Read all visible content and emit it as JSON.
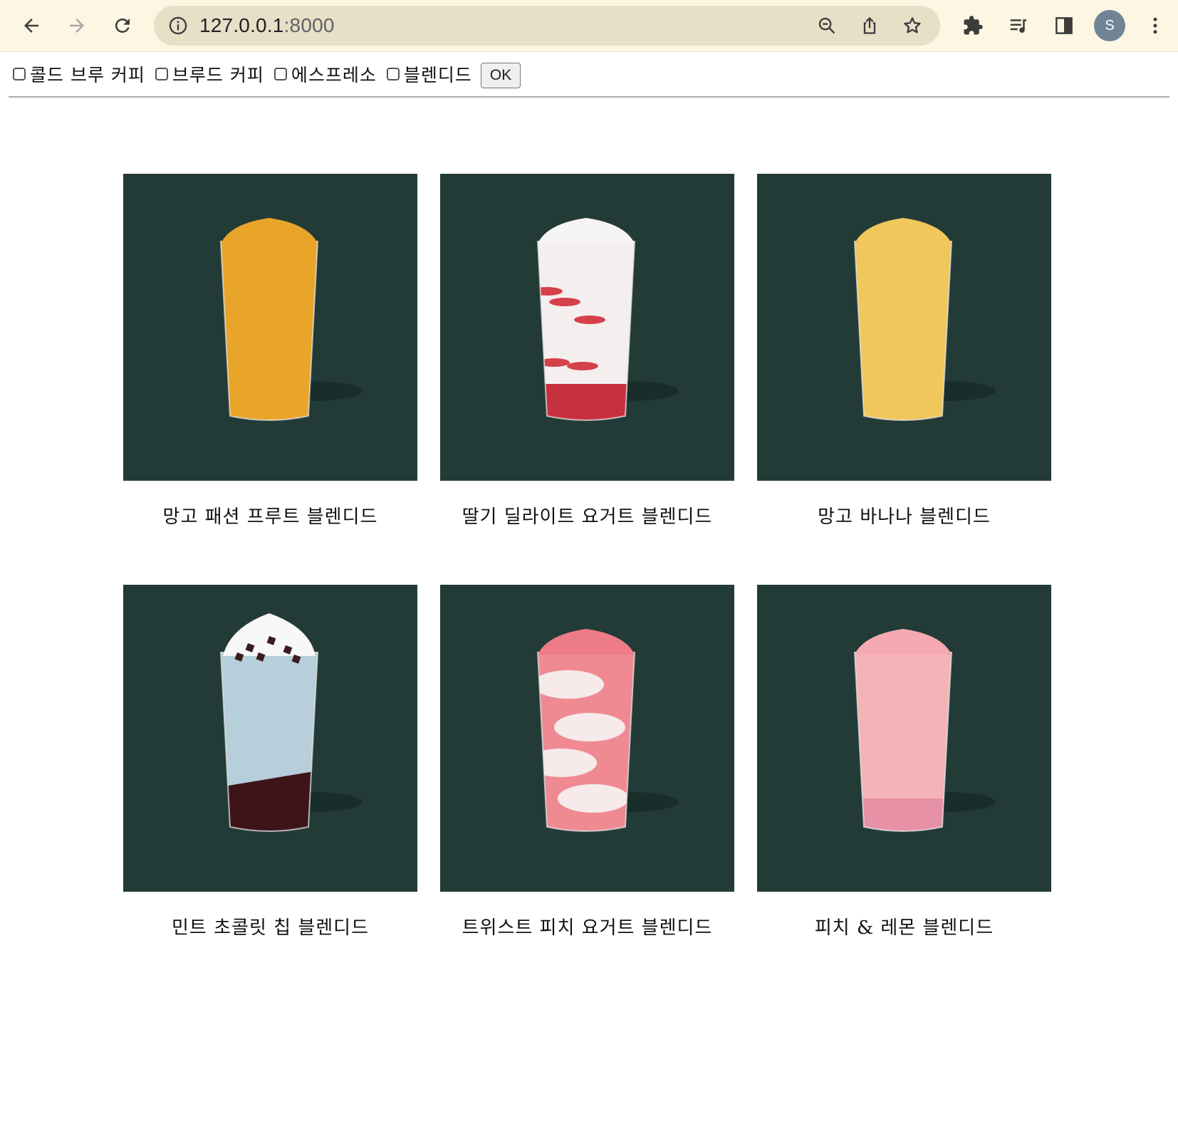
{
  "browser": {
    "url_host": "127.0.0.1",
    "url_port": ":8000",
    "profile_initial": "S",
    "icons": [
      "back-arrow-icon",
      "forward-arrow-icon",
      "reload-icon",
      "site-info-icon",
      "zoom-out-icon",
      "share-icon",
      "bookmark-star-icon",
      "extensions-puzzle-icon",
      "media-queue-icon",
      "side-panel-icon",
      "kebab-menu-icon"
    ]
  },
  "filters": {
    "options": [
      {
        "label": "콜드 브루 커피",
        "checked": false
      },
      {
        "label": "브루드 커피",
        "checked": false
      },
      {
        "label": "에스프레소",
        "checked": false
      },
      {
        "label": "블렌디드",
        "checked": false
      }
    ],
    "submit_label": "OK"
  },
  "products": [
    {
      "name": "망고 패션 프루트 블렌디드",
      "drink_color": "#e9a52a",
      "style": "solid"
    },
    {
      "name": "딸기 딜라이트 요거트 블렌디드",
      "drink_color": "#f4efee",
      "style": "strawberry"
    },
    {
      "name": "망고 바나나 블렌디드",
      "drink_color": "#f0c75a",
      "style": "solid"
    },
    {
      "name": "민트 초콜릿 칩 블렌디드",
      "drink_color": "#b7cedb",
      "style": "mint"
    },
    {
      "name": "트위스트 피치 요거트 블렌디드",
      "drink_color": "#ef8a93",
      "style": "twist"
    },
    {
      "name": "피치 & 레몬 블렌디드",
      "drink_color": "#f4b3b6",
      "style": "peach"
    }
  ],
  "colors": {
    "thumb_bg": "#233b37",
    "toolbar_bg": "#fdf6e3",
    "omnibox_bg": "#e7dfc6"
  }
}
